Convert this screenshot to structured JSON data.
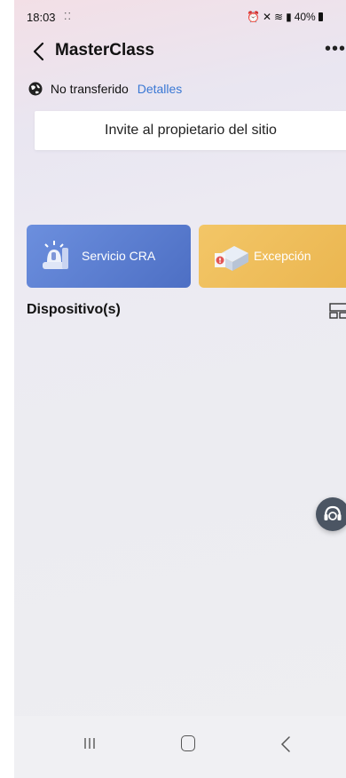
{
  "status_bar": {
    "time": "18:03",
    "dots": "⁚⁚",
    "icons": [
      "alarm-icon",
      "mute-icon",
      "wifi-icon",
      "data-icon",
      "signal-icon",
      "battery-icon"
    ],
    "battery_text": "40%"
  },
  "header": {
    "title": "MasterClass"
  },
  "transfer": {
    "status_text": "No transferido",
    "details_link": "Detalles"
  },
  "invite": {
    "label": "Invite al propietario del sitio"
  },
  "cards": {
    "cra": {
      "label": "Servicio CRA",
      "color": "#5b7fd2"
    },
    "exception": {
      "label": "Excepción",
      "color": "#efbd5a"
    }
  },
  "devices": {
    "title": "Dispositivo(s)"
  },
  "colors": {
    "accent_link": "#3a78d4"
  }
}
